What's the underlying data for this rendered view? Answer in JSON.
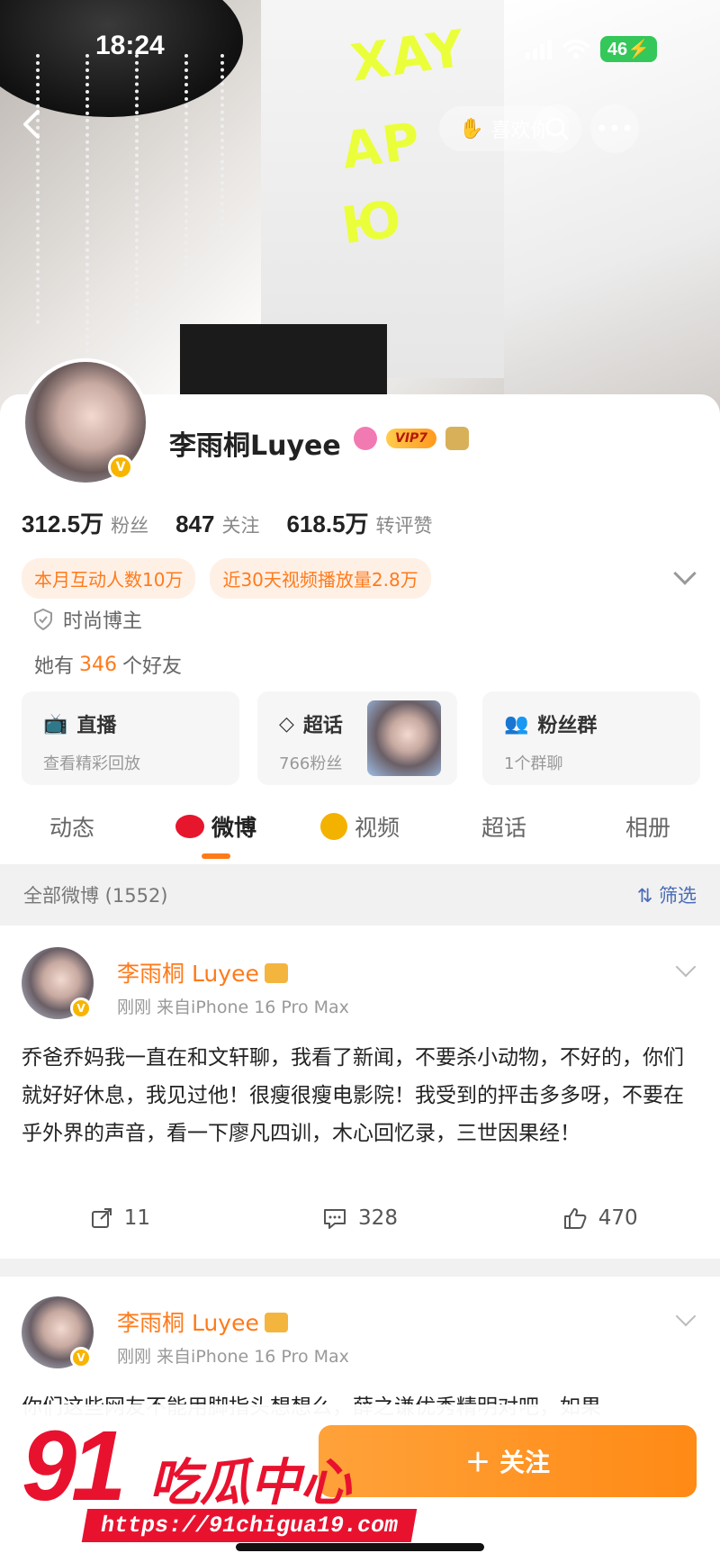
{
  "status": {
    "time": "18:24",
    "battery": "46"
  },
  "header": {
    "like_label": "喜欢你"
  },
  "cover_print": {
    "line1": "XAY",
    "line2": "AP",
    "line3": "Ю"
  },
  "profile": {
    "name": "李雨桐Luyee",
    "vip_label": "VIP7",
    "stats": [
      {
        "value": "312.5万",
        "label": "粉丝"
      },
      {
        "value": "847",
        "label": "关注"
      },
      {
        "value": "618.5万",
        "label": "转评赞"
      }
    ],
    "tags": [
      "本月互动人数10万",
      "近30天视频播放量2.8万"
    ],
    "category": "时尚博主",
    "friends_prefix": "她有",
    "friends_count": "346",
    "friends_suffix": "个好友"
  },
  "features": [
    {
      "title": "直播",
      "sub": "查看精彩回放"
    },
    {
      "title": "超话",
      "sub": "766粉丝"
    },
    {
      "title": "粉丝群",
      "sub": "1个群聊"
    }
  ],
  "tabs": [
    "动态",
    "微博",
    "视频",
    "超话",
    "相册"
  ],
  "filter": {
    "left": "全部微博 (1552)",
    "right": "筛选"
  },
  "posts": [
    {
      "name": "李雨桐 Luyee",
      "meta": "刚刚  来自iPhone 16 Pro Max",
      "text": "乔爸乔妈我一直在和文轩聊，我看了新闻，不要杀小动物，不好的，你们就好好休息，我见过他！很瘦很瘦电影院！我受到的抨击多多呀，不要在乎外界的声音，看一下廖凡四训，木心回忆录，三世因果经！",
      "reposts": "11",
      "comments": "328",
      "likes": "470"
    },
    {
      "name": "李雨桐 Luyee",
      "meta": "刚刚  来自iPhone 16 Pro Max",
      "text": "你们这些网友不能用脚指头想想么，薛之谦优秀精明对吧，如果"
    }
  ],
  "follow_label": "关注",
  "watermark": {
    "number": "91",
    "text": "吃瓜中心",
    "url": "https://91chigua19.com"
  }
}
